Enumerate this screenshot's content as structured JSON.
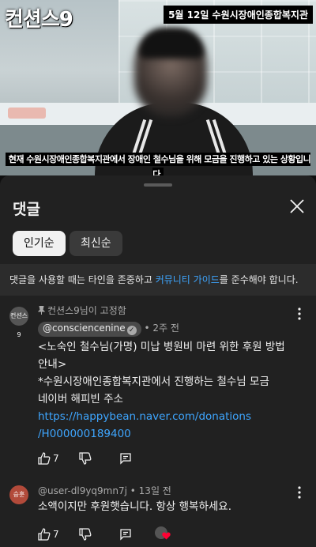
{
  "video": {
    "logo": "컨션스9",
    "top_caption": "5월 12일 수원시장애인종합복지관",
    "subtitle": "현재 수원시장애인종합복지관에서 장애인 철수님을 위해 모금을 진행하고 있는 상황입니다"
  },
  "panel": {
    "title": "댓글",
    "close_icon": "close-icon"
  },
  "filters": {
    "popular": "인기순",
    "newest": "최신순"
  },
  "notice": {
    "before": "댓글을 사용할 때는 타인을 존중하고 ",
    "link": "커뮤니티 가이드",
    "after": "를 준수해야 합니다."
  },
  "comments": [
    {
      "pinned_label": "컨션스9님이 고정함",
      "avatar_text": "컨션스9",
      "author": "@consciencenine",
      "time": "• 2주 전",
      "lines": [
        "<노숙인 철수님(가명) 미납 병원비 마련 위한 후원 방법",
        "안내>",
        "*수원시장애인종합복지관에서 진행하는 철수님 모금",
        "네이버 해피빈 주소"
      ],
      "link_lines": [
        "https://happybean.naver.com/donations",
        "/H000000189400"
      ],
      "likes": "7"
    },
    {
      "avatar_text": "승훈",
      "author": "@user-dl9yq9mn7j",
      "time": "• 13일 전",
      "text": "소액이지만 후원햇습니다. 항상 행복하세요.",
      "likes": "7"
    }
  ],
  "colors": {
    "link": "#3ea6ff",
    "background": "#212121",
    "heart": "#ff0033"
  }
}
